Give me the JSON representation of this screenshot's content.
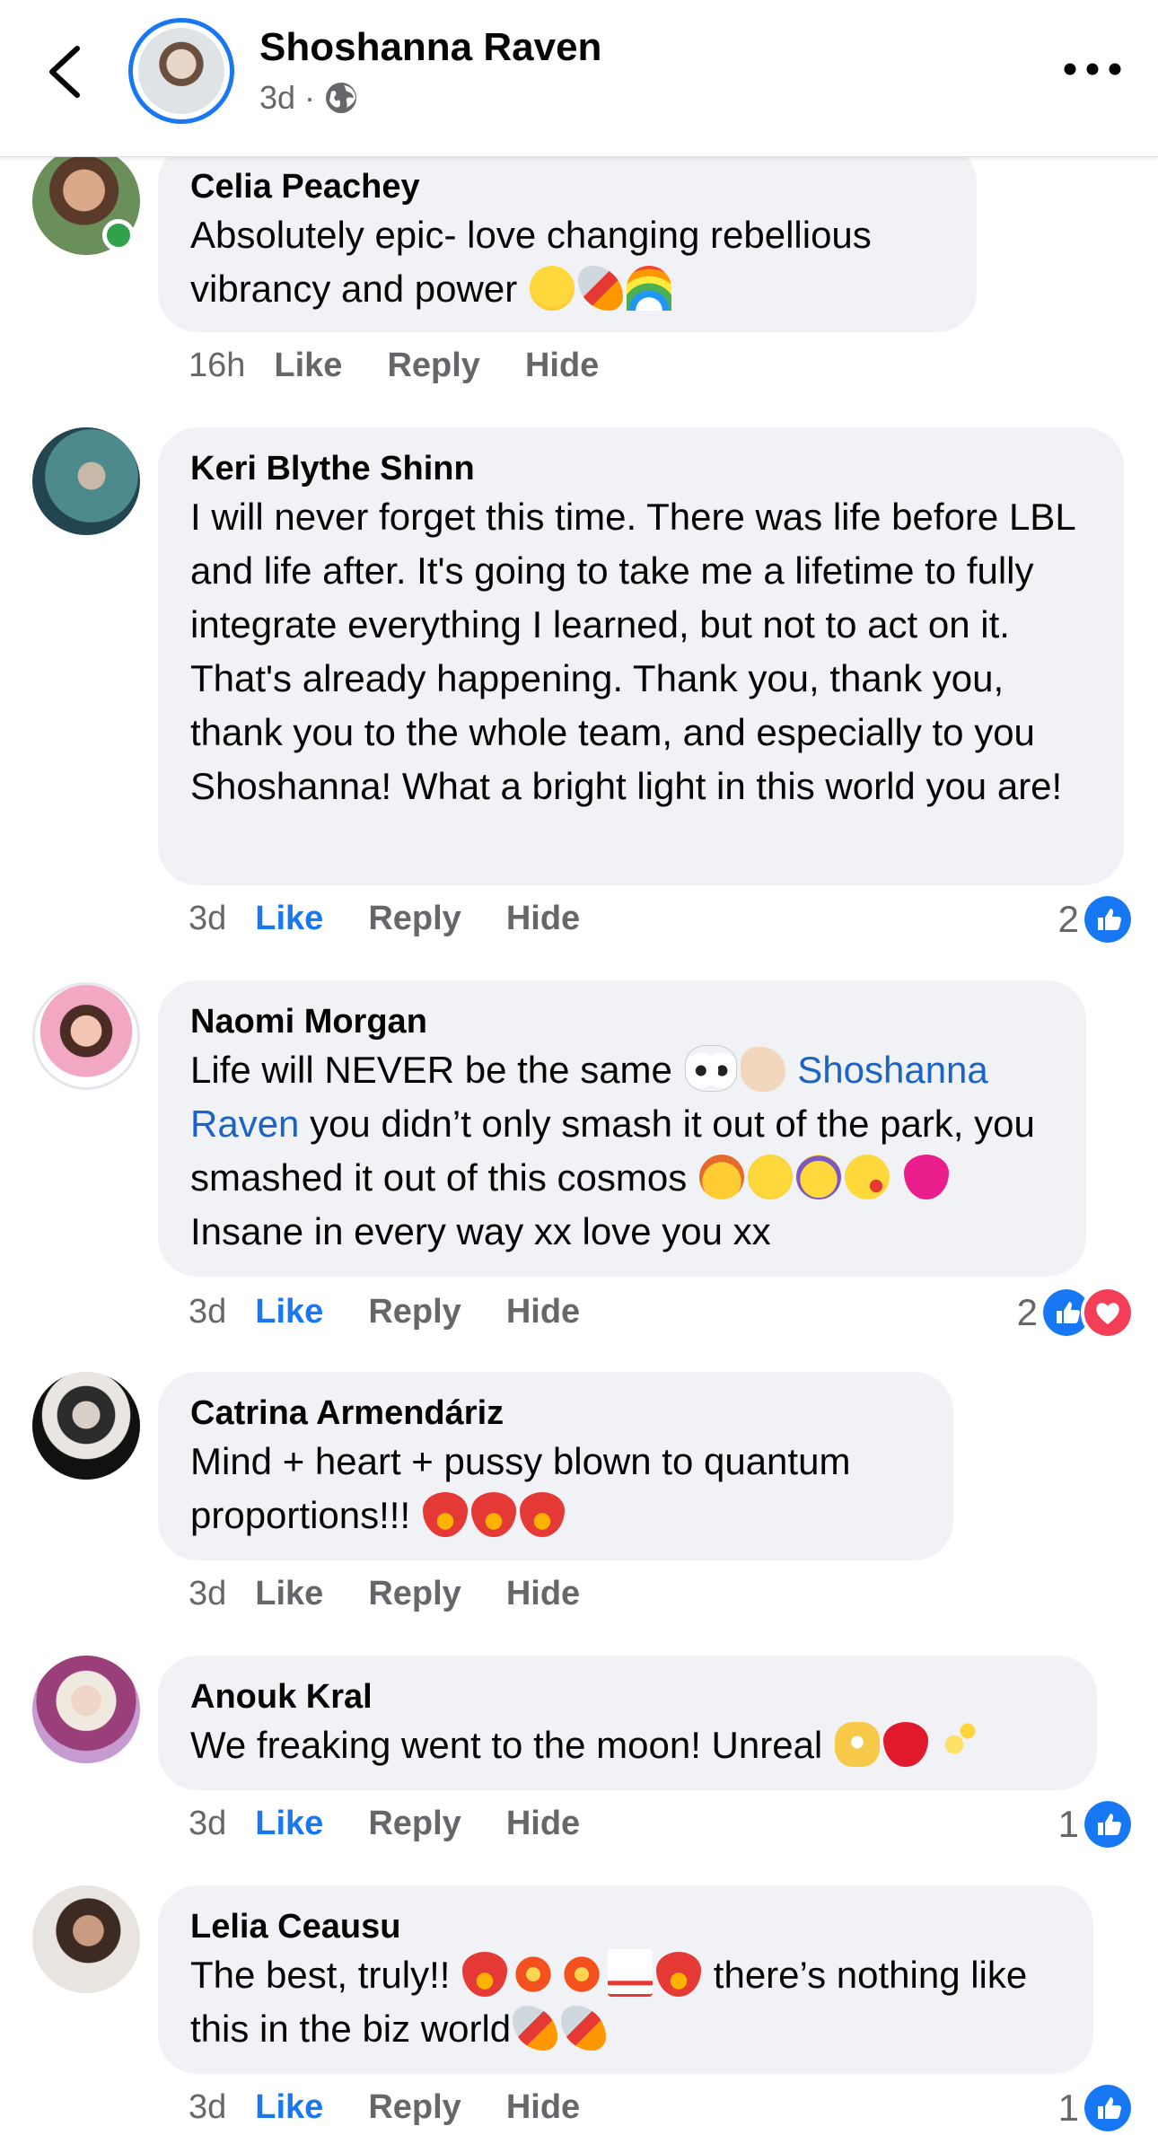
{
  "header": {
    "name": "Shoshanna Raven",
    "time": "3d",
    "separator": "·",
    "privacy_icon": "globe-icon"
  },
  "comments": [
    {
      "author": "Celia Peachey",
      "text": "Absolutely epic- love changing rebellious vibrancy and power",
      "emojis": [
        "winking-face-with-tongue",
        "rocket",
        "rainbow"
      ],
      "time": "16h",
      "like": "Like",
      "reply": "Reply",
      "hide": "Hide",
      "online": true
    },
    {
      "author": "Keri Blythe Shinn",
      "text": "I will never forget this time.  There was life before LBL and life after.  It's going to take me a lifetime to fully integrate everything I learned, but not to act on it.  That's already happening. Thank you, thank you, thank you to the whole team, and especially to you Shoshanna!  What a bright light in this world you are!",
      "time": "3d",
      "like": "Like",
      "reply": "Reply",
      "hide": "Hide",
      "liked": true,
      "reaction_count": "2",
      "reactions": [
        "like"
      ]
    },
    {
      "author": "Naomi Morgan",
      "text_before": "Life will NEVER be the same",
      "emojis_a": [
        "eyes",
        "pinching-hand"
      ],
      "mention": "Shoshanna Raven",
      "text_mid": " you didn’t only smash it out of the park, you smashed it out of this cosmos",
      "emojis_b": [
        "exploding-head",
        "star-struck",
        "partying-face",
        "face-blowing-kiss",
        "growing-heart"
      ],
      "text_after": " Insane in every way xx love you xx",
      "time": "3d",
      "like": "Like",
      "reply": "Reply",
      "hide": "Hide",
      "liked": true,
      "reaction_count": "2",
      "reactions": [
        "like",
        "love"
      ]
    },
    {
      "author": "Catrina Armendáriz",
      "text": "Mind + heart + pussy blown to quantum proportions!!!",
      "emojis": [
        "heart-on-fire",
        "heart-on-fire",
        "heart-on-fire"
      ],
      "time": "3d",
      "like": "Like",
      "reply": "Reply",
      "hide": "Hide"
    },
    {
      "author": "Anouk Kral",
      "text": "We freaking went to the moon! Unreal",
      "emojis": [
        "heart-hands",
        "red-heart",
        "sparkles"
      ],
      "time": "3d",
      "like": "Like",
      "reply": "Reply",
      "hide": "Hide",
      "liked": true,
      "reaction_count": "1",
      "reactions": [
        "like"
      ]
    },
    {
      "author": "Lelia Ceausu",
      "text_before": "The best, truly!!",
      "emojis_a": [
        "heart-on-fire",
        "collision",
        "collision",
        "hundred-points",
        "heart-on-fire"
      ],
      "text_mid": " there’s nothing like this in the biz world",
      "emojis_b": [
        "rocket",
        "rocket"
      ],
      "time": "3d",
      "like": "Like",
      "reply": "Reply",
      "hide": "Hide",
      "liked": true,
      "reaction_count": "1",
      "reactions": [
        "like"
      ]
    }
  ],
  "colors": {
    "accent": "#1877f2",
    "bubble": "#f0f2f5",
    "secondary_text": "#65676b",
    "love": "#f33e58",
    "online": "#31a24c"
  }
}
